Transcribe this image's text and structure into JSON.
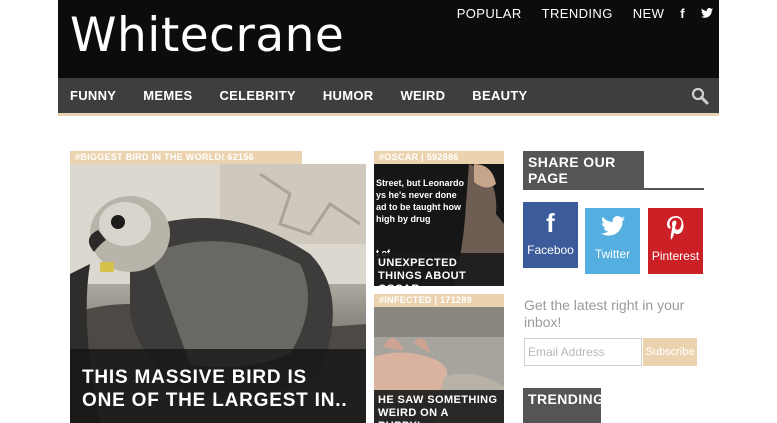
{
  "header": {
    "logo": "Whitecrane",
    "top_links": [
      "POPULAR",
      "TRENDING",
      "NEW"
    ],
    "social": [
      {
        "icon": "facebook-icon",
        "glyph": "f"
      },
      {
        "icon": "twitter-icon",
        "glyph": "t"
      }
    ]
  },
  "nav": {
    "items": [
      "FUNNY",
      "MEMES",
      "CELEBRITY",
      "HUMOR",
      "WEIRD",
      "BEAUTY"
    ],
    "search_icon": "search-icon"
  },
  "featured": {
    "tag": "#BIGGEST BIRD IN THE WORLD! 62156",
    "caption": "THIS MASSIVE BIRD IS ONE OF THE LARGEST IN.."
  },
  "small_posts": [
    {
      "tag": "#OSCAR | 592886",
      "caption": "UNEXPECTED THINGS ABOUT OSCAR...",
      "image_text": [
        "Street, but Leonardo",
        "ys he's never done",
        "ad to be taught how",
        "high by drug",
        "t of"
      ]
    },
    {
      "tag": "#INFECTED | 171289",
      "caption": "HE SAW SOMETHING WEIRD ON A PUPPY'..."
    }
  ],
  "sidebar": {
    "share_title": "SHARE OUR PAGE",
    "share_buttons": [
      {
        "label": "Faceboo",
        "glyph": "f",
        "color": "#3b5b9a",
        "icon": "facebook-icon"
      },
      {
        "label": "Twitter",
        "glyph": "❧",
        "color": "#54aee0",
        "icon": "twitter-icon"
      },
      {
        "label": "Pinterest",
        "glyph": "P",
        "color": "#cb2026",
        "icon": "pinterest-icon"
      }
    ],
    "inbox_text": "Get the latest right in your inbox!",
    "email_placeholder": "Email Address",
    "subscribe_label": "Subscribe",
    "trending_title": "TRENDING"
  },
  "colors": {
    "header_bg": "#0c0c0c",
    "nav_bg": "#3e3e3e",
    "accent": "#ecd3b0"
  }
}
